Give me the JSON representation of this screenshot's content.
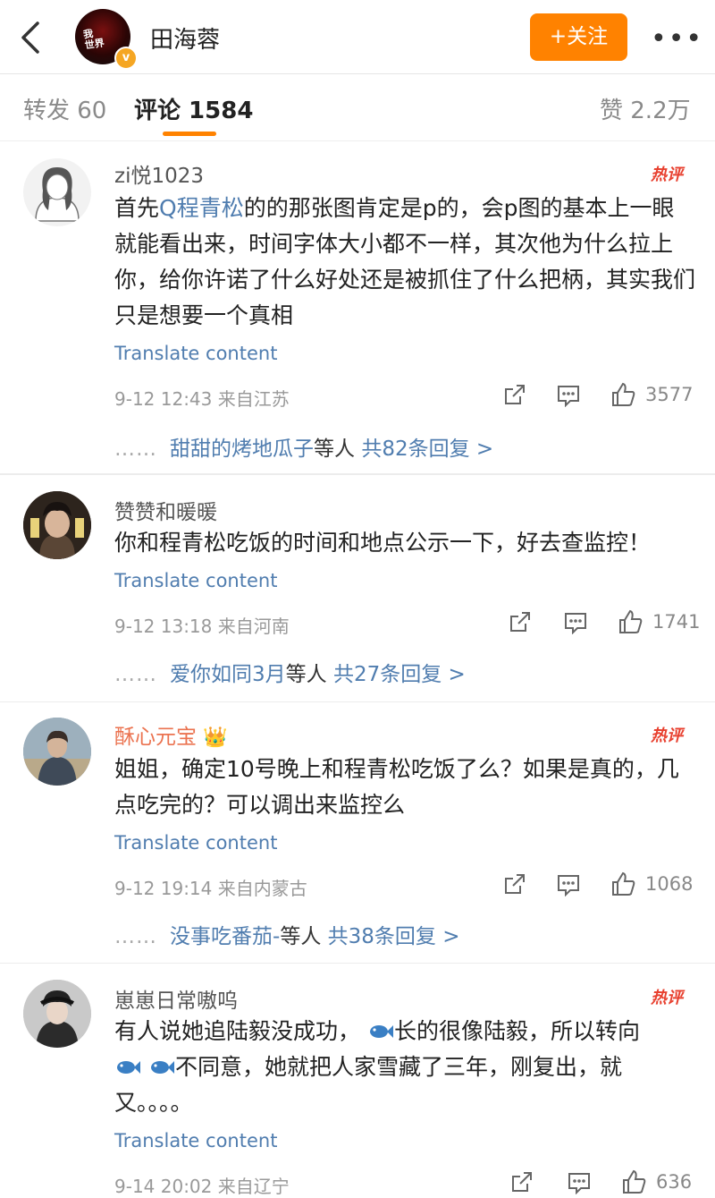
{
  "header": {
    "back_icon": "chevron-left-icon",
    "title": "田海蓉",
    "follow_label": "+关注",
    "more_label": "•••",
    "accent": "#ff8200"
  },
  "tabs": [
    {
      "label": "转发 60"
    },
    {
      "label": "评论 1584"
    },
    {
      "label": "赞 2.2万"
    }
  ],
  "comments": [
    {
      "username": "zi悦1023",
      "hot_badge": "热评",
      "text_before": "首先",
      "mention": "Q程青松",
      "text_after": "的的那张图肯定是p的，会p图的基本上一眼就能看出来，时间字体大小都不一样，其次他为什么拉上你，给你许诺了什么好处还是被抓住了什么把柄，其实我们只是想要一个真相",
      "translate": "Translate content",
      "meta": "9-12 12:43  来自江苏",
      "likes": "3577",
      "reply_user": "甜甜的烤地瓜子",
      "reply_mid": "等人",
      "reply_count": "共82条回复 >"
    },
    {
      "username": "赞赞和暖暖",
      "text": "你和程青松吃饭的时间和地点公示一下，好去查监控！",
      "translate": "Translate content",
      "meta": "9-12 13:18  来自河南",
      "likes": "1741",
      "reply_user": "爱你如同3月",
      "reply_mid": "等人",
      "reply_count": "共27条回复 >"
    },
    {
      "username": "酥心元宝",
      "crown": "👑",
      "hot_badge": "热评",
      "text": "姐姐，确定10号晚上和程青松吃饭了么？如果是真的，几点吃完的？可以调出来监控么",
      "translate": "Translate content",
      "meta": "9-12 19:14  来自内蒙古",
      "likes": "1068",
      "reply_user": "没事吃番茄-",
      "reply_mid": "等人",
      "reply_count": "共38条回复 >"
    },
    {
      "username": "崽崽日常嗷呜",
      "hot_badge": "热评",
      "text_a": "有人说她追陆毅没成功，",
      "text_b": "长的很像陆毅，所以转向",
      "text_c": "不同意，她就把人家雪藏了三年，刚复出，就又。。。。",
      "translate": "Translate content",
      "meta": "9-14 20:02  来自辽宁",
      "likes": "636"
    }
  ]
}
